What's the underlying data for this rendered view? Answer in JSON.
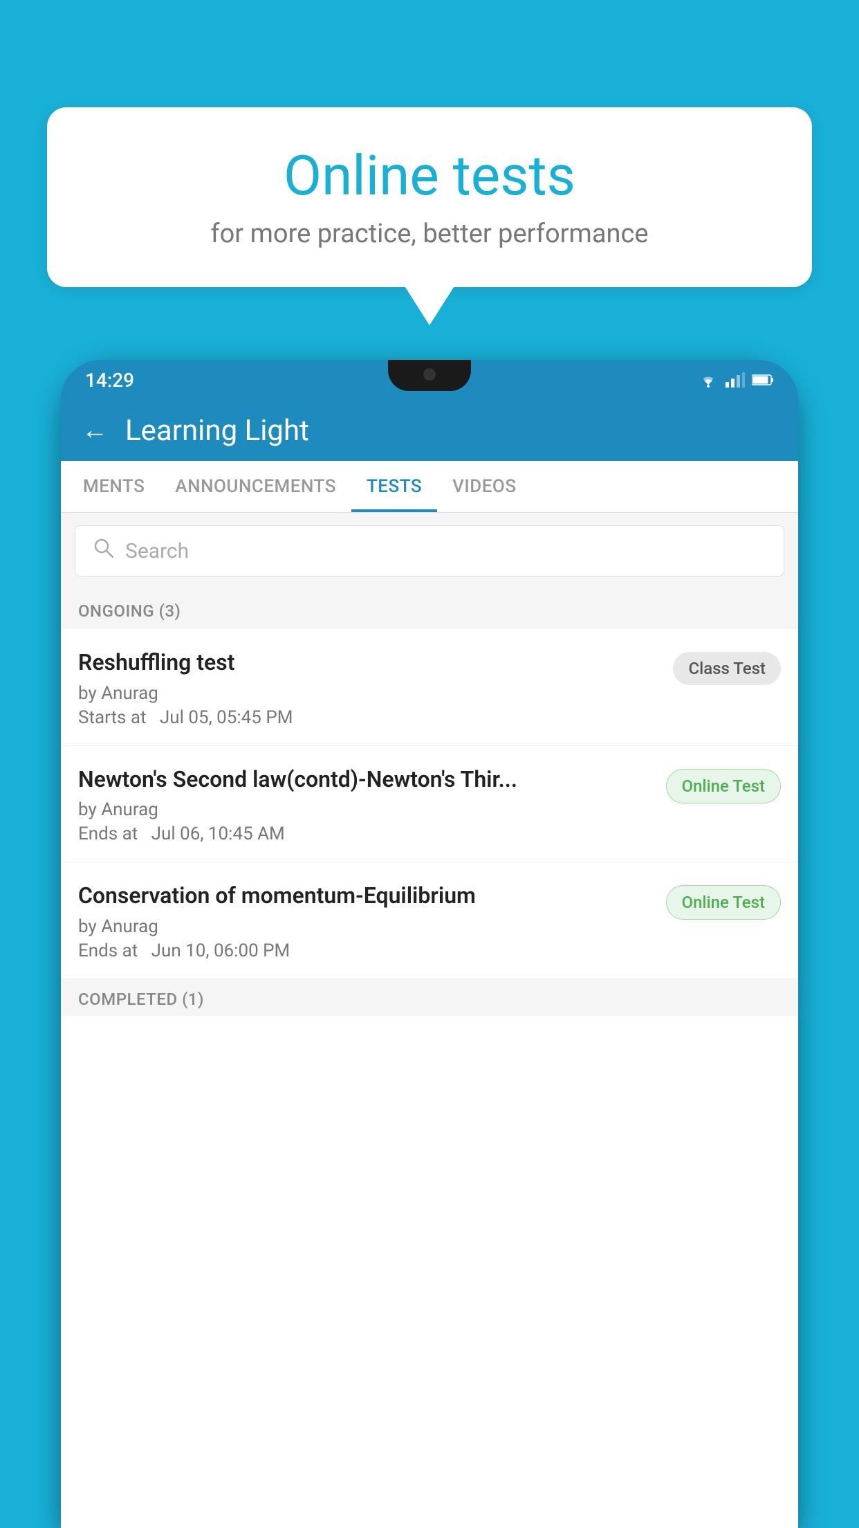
{
  "background": {
    "color": "#19b0d8"
  },
  "speech_bubble": {
    "title": "Online tests",
    "subtitle": "for more practice, better performance"
  },
  "phone": {
    "status_bar": {
      "time": "14:29",
      "icons": [
        "wifi",
        "signal",
        "battery"
      ]
    },
    "app_header": {
      "title": "Learning Light",
      "back_label": "←"
    },
    "tabs": [
      {
        "label": "MENTS",
        "active": false
      },
      {
        "label": "ANNOUNCEMENTS",
        "active": false
      },
      {
        "label": "TESTS",
        "active": true
      },
      {
        "label": "VIDEOS",
        "active": false
      }
    ],
    "search": {
      "placeholder": "Search"
    },
    "ongoing_section": {
      "label": "ONGOING (3)"
    },
    "test_items": [
      {
        "title": "Reshuffling test",
        "author": "by Anurag",
        "date": "Starts at  Jul 05, 05:45 PM",
        "badge": "Class Test",
        "badge_type": "class"
      },
      {
        "title": "Newton's Second law(contd)-Newton's Thir...",
        "author": "by Anurag",
        "date": "Ends at  Jul 06, 10:45 AM",
        "badge": "Online Test",
        "badge_type": "online"
      },
      {
        "title": "Conservation of momentum-Equilibrium",
        "author": "by Anurag",
        "date": "Ends at  Jun 10, 06:00 PM",
        "badge": "Online Test",
        "badge_type": "online"
      }
    ],
    "completed_label": "COMPLETED (1)"
  }
}
